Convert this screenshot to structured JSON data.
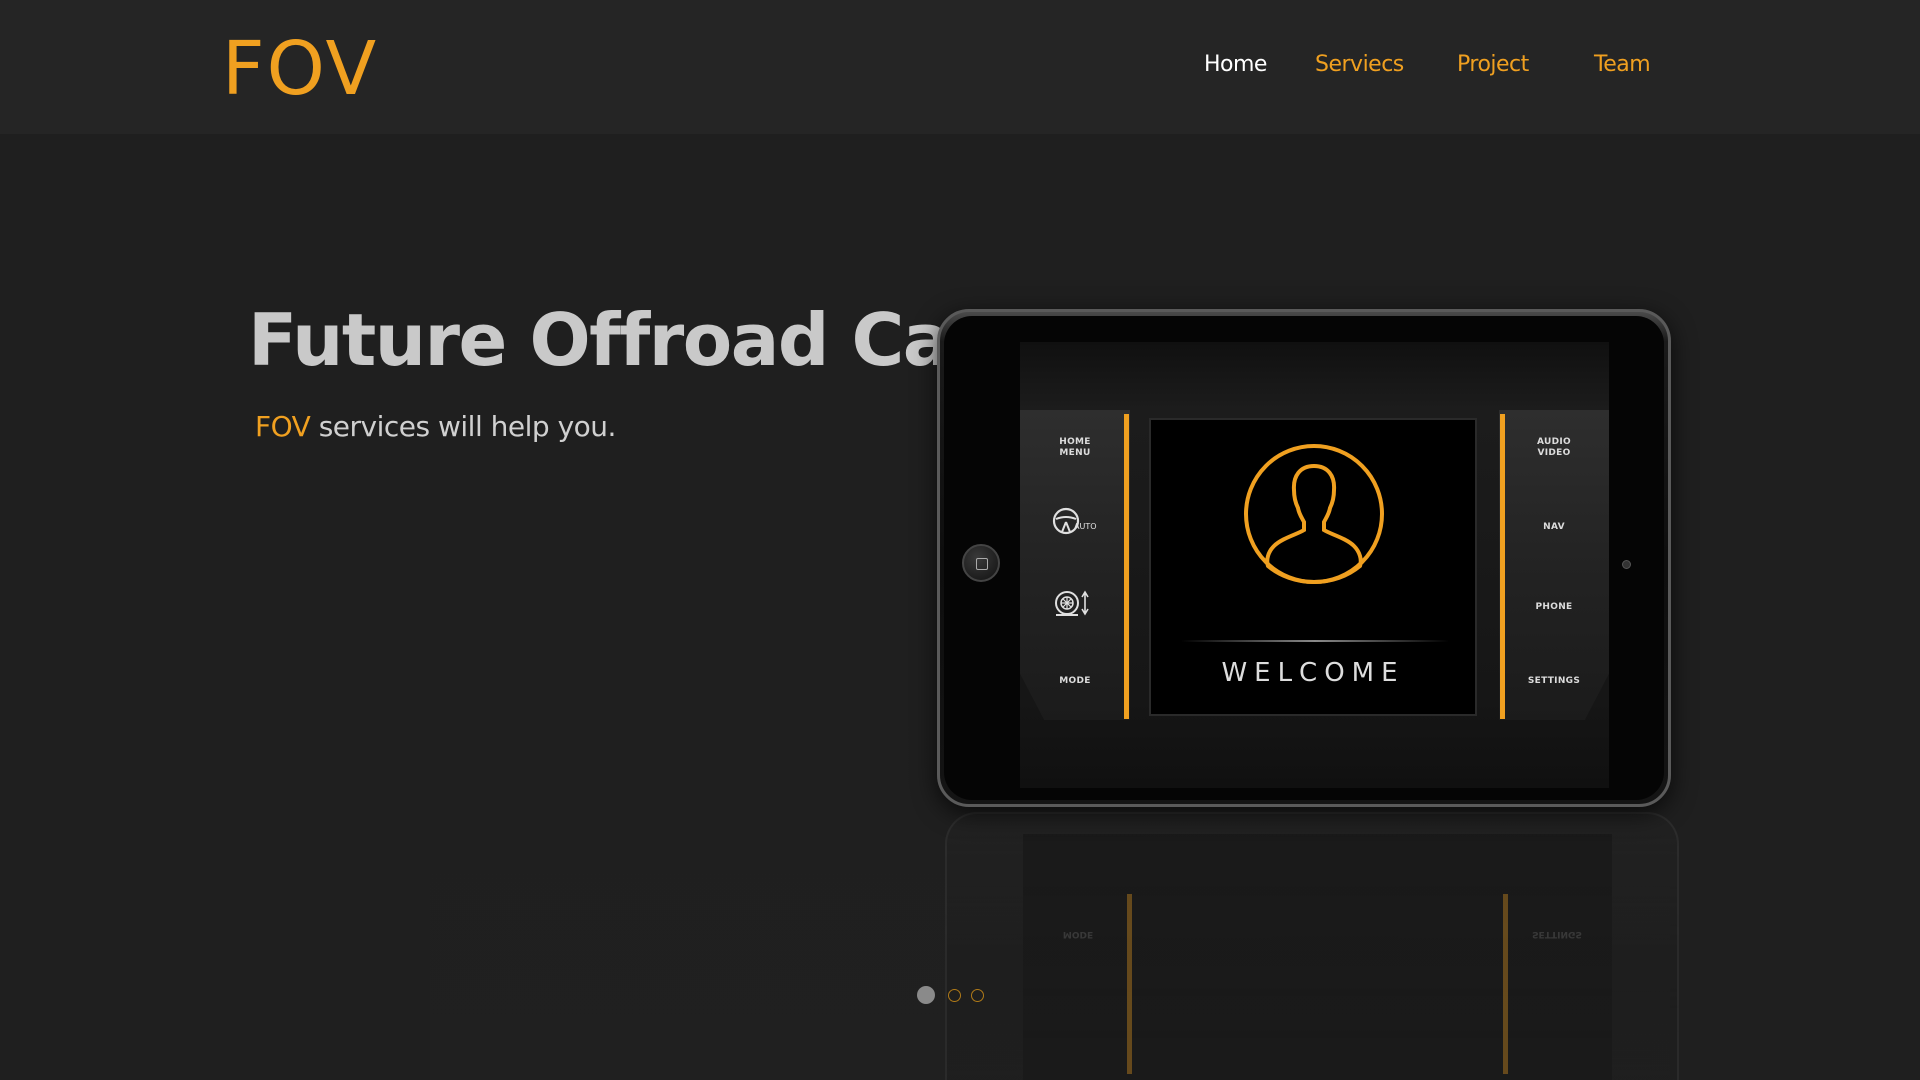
{
  "header": {
    "logo": "FOV",
    "nav": [
      {
        "label": "Home",
        "active": true
      },
      {
        "label": "Serviecs",
        "active": false
      },
      {
        "label": "Project",
        "active": false
      },
      {
        "label": "Team",
        "active": false
      }
    ]
  },
  "hero": {
    "title": "Future Offroad Car",
    "subtitle_brand": "FOV",
    "subtitle_rest": " services will help you."
  },
  "device": {
    "left_panel": {
      "home_menu_line1": "HOME",
      "home_menu_line2": "MENU",
      "auto_label": "AUTO",
      "mode_label": "MODE"
    },
    "right_panel": {
      "audio_video_line1": "AUDIO",
      "audio_video_line2": "VIDEO",
      "nav_label": "NAV",
      "phone_label": "PHONE",
      "settings_label": "SETTINGS"
    },
    "welcome_text": "WELCOME",
    "icons": [
      "steering-wheel-icon",
      "wheel-adjust-icon",
      "user-avatar-icon"
    ]
  },
  "slider": {
    "slides_count": 3,
    "active_index": 0
  },
  "colors": {
    "accent": "#f0a020",
    "background": "#1f1f1f",
    "header_bg": "#252525",
    "nav_active": "#ffffff"
  }
}
